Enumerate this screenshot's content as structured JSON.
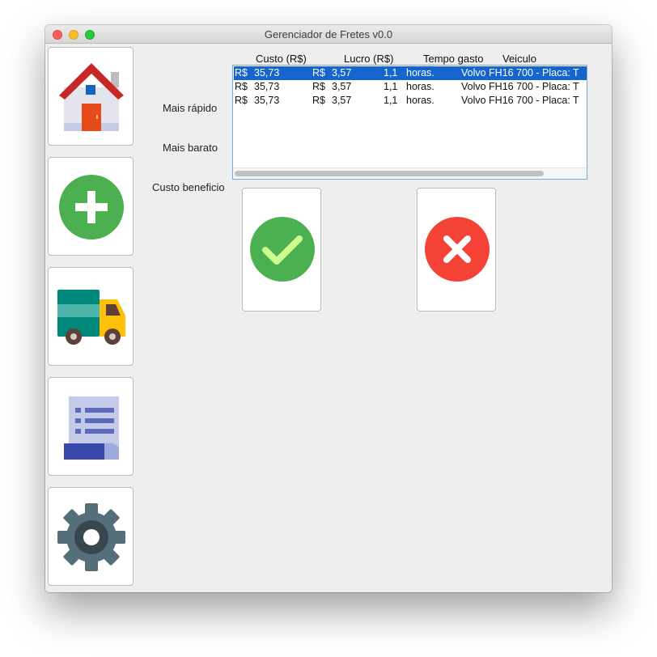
{
  "window": {
    "title": "Gerenciador de Fretes v0.0"
  },
  "sidebar": {
    "items": [
      {
        "name": "home",
        "icon": "house-icon"
      },
      {
        "name": "add",
        "icon": "plus-circle-icon"
      },
      {
        "name": "freight",
        "icon": "truck-icon"
      },
      {
        "name": "report",
        "icon": "document-icon"
      },
      {
        "name": "settings",
        "icon": "gear-icon"
      }
    ]
  },
  "labels": {
    "fastest": "Mais rápido",
    "cheapest": "Mais barato",
    "cost_benefit": "Custo beneficio"
  },
  "table": {
    "columns": [
      "Custo (R$)",
      "Lucro (R$)",
      "Tempo gasto",
      "Veiculo"
    ],
    "rows": [
      {
        "cost_symbol": "R$",
        "cost": "35,73",
        "profit_symbol": "R$",
        "profit": "3,57",
        "time": "1,1",
        "time_unit": "horas.",
        "vehicle": "Volvo FH16 700 - Placa: T",
        "selected": true
      },
      {
        "cost_symbol": "R$",
        "cost": "35,73",
        "profit_symbol": "R$",
        "profit": "3,57",
        "time": "1,1",
        "time_unit": "horas.",
        "vehicle": "Volvo FH16 700 - Placa: T",
        "selected": false
      },
      {
        "cost_symbol": "R$",
        "cost": "35,73",
        "profit_symbol": "R$",
        "profit": "3,57",
        "time": "1,1",
        "time_unit": "horas.",
        "vehicle": "Volvo FH16 700 - Placa: T",
        "selected": false
      }
    ]
  },
  "actions": {
    "confirm_icon": "check-circle-icon",
    "cancel_icon": "x-circle-icon"
  },
  "colors": {
    "selection": "#1665cf",
    "confirm": "#4caf50",
    "cancel": "#f44336",
    "gear": "#546e7a"
  }
}
